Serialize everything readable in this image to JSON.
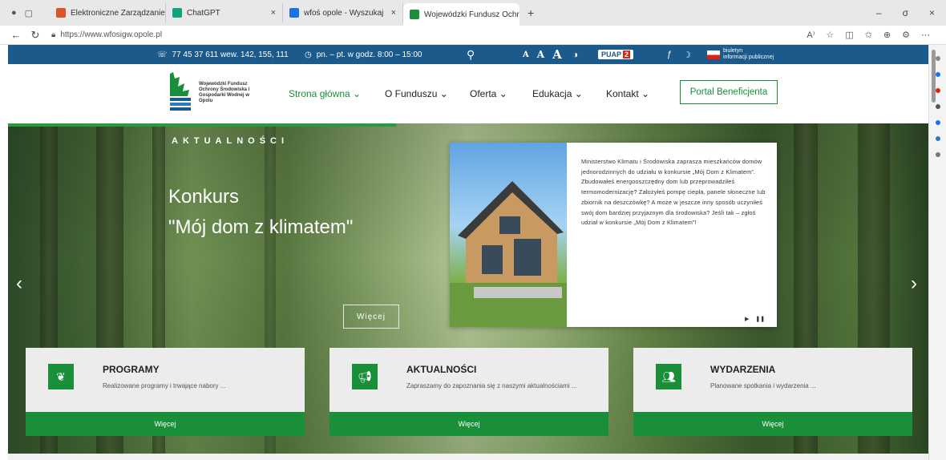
{
  "browser": {
    "tabs": [
      {
        "title": "Elektroniczne Zarządzanie Doku",
        "color": "#d9532b"
      },
      {
        "title": "ChatGPT",
        "color": "#10a37f"
      },
      {
        "title": "wfoś opole - Wyszukaj",
        "color": "#1a73e8"
      },
      {
        "title": "Wojewódzki Fundusz Ochrony Śr",
        "color": "#1a8f3a"
      }
    ],
    "new_tab": "+",
    "url": "https://www.wfosigw.opole.pl",
    "window_controls": [
      "–",
      "σ",
      "×"
    ]
  },
  "topbar": {
    "phone": "77 45 37 611 wew. 142, 155, 111",
    "hours": "pn. – pt. w godz. 8:00 – 15:00",
    "font_sizes": [
      "A",
      "A",
      "A"
    ],
    "pupa_label": "PUAP",
    "pupa_badge": "2",
    "bip_line1": "biuletyn",
    "bip_line2": "informacji publicznej"
  },
  "header": {
    "logo_text": "Wojewódzki Fundusz Ochrony Środowiska i Gospodarki Wodnej w Opolu",
    "nav": [
      {
        "label": "Strona główna ⌄"
      },
      {
        "label": "O Funduszu ⌄"
      },
      {
        "label": "Oferta ⌄"
      },
      {
        "label": "Edukacja ⌄"
      },
      {
        "label": "Kontakt ⌄"
      }
    ],
    "portal": "Portal Beneficjenta"
  },
  "hero": {
    "kicker": "AKTUALNOŚCI",
    "title_line1": "Konkurs",
    "title_line2": "\"Mój dom z klimatem\"",
    "more": "Więcej",
    "card_text": "Ministerstwo Klimatu i Środowiska zaprasza mieszkańców domów jednorodzinnych do udziału w konkursie „Mój Dom z Klimatem”. Zbudowałeś energooszczędny dom lub przeprowadziłeś termomodernizację? Założyłeś pompę ciepła, panele słoneczne lub zbiornik na deszczówkę? A może w jeszcze inny sposób uczyniłeś swój dom bardziej przyjaznym dla środowiska? Jeśli tak – zgłoś udział w konkursie „Mój Dom z Klimatem”!",
    "play": "▶",
    "pause": "❚❚"
  },
  "boxes": [
    {
      "title": "PROGRAMY",
      "desc": "Realizowane programy i trwające nabory ...",
      "button": "Więcej"
    },
    {
      "title": "AKTUALNOŚCI",
      "desc": "Zapraszamy do zapoznania się z naszymi aktualnościami ...",
      "button": "Więcej"
    },
    {
      "title": "WYDARZENIA",
      "desc": "Planowane spotkania i wydarzenia ...",
      "button": "Więcej"
    }
  ],
  "colors": {
    "brand_green": "#1a8f3a",
    "topbar_blue": "#1b5a8b"
  }
}
